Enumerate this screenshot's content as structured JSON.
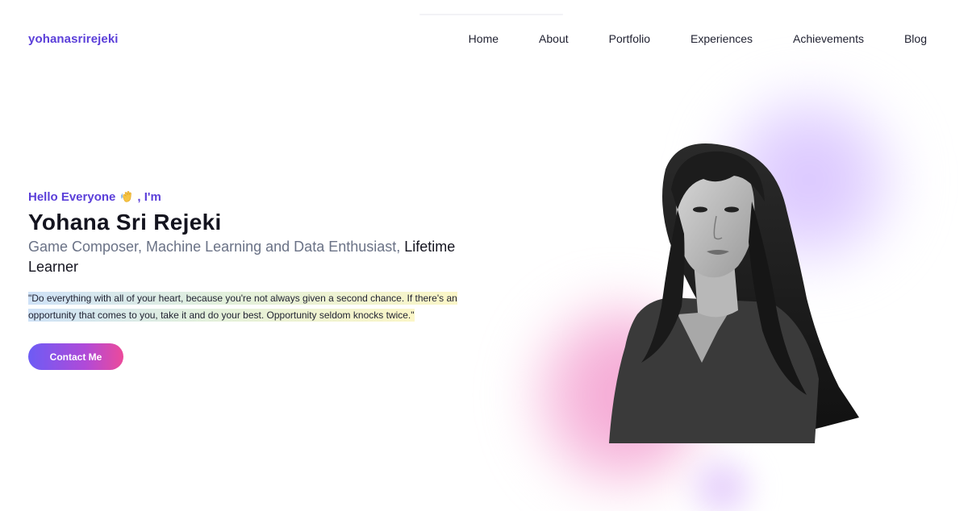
{
  "header": {
    "logo": "yohanasrirejeki",
    "nav": [
      {
        "label": "Home"
      },
      {
        "label": "About"
      },
      {
        "label": "Portfolio"
      },
      {
        "label": "Experiences"
      },
      {
        "label": "Achievements"
      },
      {
        "label": "Blog"
      }
    ]
  },
  "hero": {
    "greeting_prefix": "Hello Everyone",
    "greeting_suffix": ", I'm",
    "wave_icon": "waving-hand-icon",
    "name": "Yohana Sri Rejeki",
    "roles_muted": "Game Composer, Machine Learning and Data Enthusiast, ",
    "roles_emphasis": "Lifetime Learner",
    "quote": "\"Do everything with all of your heart, because you're not always given a second chance. If there's an opportunity that comes to you, take it and do your best. Opportunity seldom knocks twice.\"",
    "contact_label": "Contact Me"
  },
  "colors": {
    "brand": "#5b3fd9",
    "button_gradient_start": "#6d5cf5",
    "button_gradient_end": "#ec4a9b",
    "blob_purple": "#d6bfff",
    "blob_pink": "#f4a0cf"
  }
}
